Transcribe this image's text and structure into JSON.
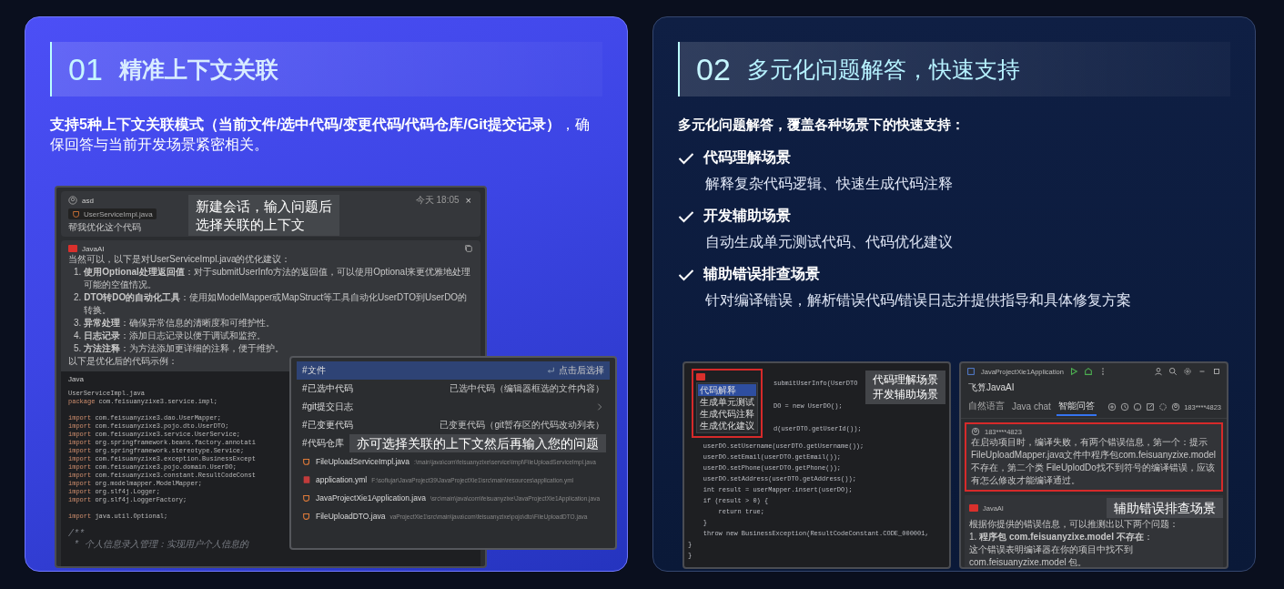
{
  "context_card": {
    "number": "01",
    "title": "精准上下文关联",
    "description": "**支持5种上下文关联模式（当前文件/选中代码/变更代码/代码仓库/Git提交记录）**，确保回答与当前开发场景紧密相关。",
    "chat_window": {
      "user": "asd",
      "file_chip": "UserServiceImpl.java",
      "time": "今天 18:05",
      "close": "×",
      "question": "帮我优化这个代码",
      "ai_name": "JavaAI",
      "intro": "当然可以，以下是对UserServiceImpl.java的优化建议：",
      "suggestions": [
        {
          "marker": "1.",
          "text": "**使用Optional处理返回值**：对于submitUserInfo方法的返回值，可以使用Optional来更优雅地处理可能的空值情况。"
        },
        {
          "marker": "2.",
          "text": "**DTO转DO的自动化工具**：使用如ModelMapper或MapStruct等工具自动化UserDTO到UserDO的转换。"
        },
        {
          "marker": "3.",
          "text": "**异常处理**：确保异常信息的清晰度和可维护性。"
        },
        {
          "marker": "4.",
          "text": "**日志记录**：添加日志记录以便于调试和监控。"
        },
        {
          "marker": "5.",
          "text": "**方法注释**：为方法添加更详细的注释，便于维护。"
        }
      ],
      "outro": "以下是优化后的代码示例：",
      "code_language": "Java",
      "code_lines": [
        {
          "kind": "plain",
          "text": "UserServiceImpl.java"
        },
        {
          "kind": "statement",
          "keyword": "package",
          "text": " com.feisuanyzixe3.service.impl;"
        },
        {
          "kind": "blank"
        },
        {
          "kind": "statement",
          "keyword": "import",
          "text": " com.feisuanyzixe3.dao.UserMapper;"
        },
        {
          "kind": "statement",
          "keyword": "import",
          "text": " com.feisuanyzixe3.pojo.dto.UserDTO;"
        },
        {
          "kind": "statement",
          "keyword": "import",
          "text": " com.feisuanyzixe3.service.UserService;"
        },
        {
          "kind": "statement",
          "keyword": "import",
          "text": " org.springframework.beans.factory.annotati"
        },
        {
          "kind": "statement",
          "keyword": "import",
          "text": " org.springframework.stereotype.Service;"
        },
        {
          "kind": "statement",
          "keyword": "import",
          "text": " com.feisuanyzixe3.exception.BusinessExcept"
        },
        {
          "kind": "statement",
          "keyword": "import",
          "text": " com.feisuanyzixe3.pojo.domain.UserDO;"
        },
        {
          "kind": "statement",
          "keyword": "import",
          "text": " com.feisuanyzixe3.constant.ResultCodeConst"
        },
        {
          "kind": "statement",
          "keyword": "import",
          "text": " org.modelmapper.ModelMapper;"
        },
        {
          "kind": "statement",
          "keyword": "import",
          "text": " org.slf4j.Logger;"
        },
        {
          "kind": "statement",
          "keyword": "import",
          "text": " org.slf4j.LoggerFactory;"
        },
        {
          "kind": "blank"
        },
        {
          "kind": "statement",
          "keyword": "import",
          "text": " java.util.Optional;"
        },
        {
          "kind": "blank"
        },
        {
          "kind": "comment",
          "text": "/**"
        },
        {
          "kind": "comment",
          "text": " * 个人信息录入管理：实现用户个人信息的"
        }
      ]
    },
    "context_popup": {
      "items": [
        {
          "kind": "hint",
          "label": "#文件",
          "hint": "点击后选择",
          "selected": true
        },
        {
          "kind": "hint",
          "label": "#已选中代码",
          "hint": "已选中代码（编辑器框选的文件内容）",
          "selected": false
        },
        {
          "kind": "submenu",
          "label": "#git提交日志",
          "selected": false
        },
        {
          "kind": "hint",
          "label": "#已变更代码",
          "hint": "已变更代码（git暂存区的代码改动列表）",
          "selected": false
        },
        {
          "kind": "plain",
          "label": "#代码仓库",
          "selected": false
        }
      ],
      "files": [
        {
          "kind": "java",
          "name": "FileUploadServiceImpl.java",
          "path": ":\\main\\java\\com\\feisuanyzixe\\service\\impl\\FileUploadServiceImpl.java"
        },
        {
          "kind": "yaml",
          "name": "application.yml",
          "path": "F:\\sofiujar\\JavaProject39\\JavaProjectXie1\\src\\main\\resources\\application.yml"
        },
        {
          "kind": "java",
          "name": "JavaProjectXie1Application.java",
          "path": "\\src\\main\\java\\com\\feisuanyzixe\\JavaProjectXie1Application.java"
        },
        {
          "kind": "java",
          "name": "FileUploadDTO.java",
          "path": "vaProjectXie1\\src\\main\\java\\com\\feisuanyzixe\\pojo\\dto\\FileUploadDTO.java"
        }
      ]
    },
    "callouts": [
      {
        "lines": [
          "新建会话，输入问题后",
          "选择关联的上下文"
        ]
      },
      {
        "lines": [
          "亦可选择关联的上下文然后再输入您的问题"
        ]
      }
    ]
  },
  "support_card": {
    "number": "02",
    "title": "多元化问题解答，快速支持",
    "lead": "多元化问题解答，覆盖各种场景下的快速支持：",
    "features": [
      {
        "title": "代码理解场景",
        "description": "解释复杂代码逻辑、快速生成代码注释"
      },
      {
        "title": "开发辅助场景",
        "description": "自动生成单元测试代码、代码优化建议"
      },
      {
        "title": "辅助错误排查场景",
        "description": "针对编译错误，解析错误代码/错误日志并提供指导和具体修复方案"
      }
    ],
    "editor_window": {
      "menu_items": [
        {
          "label": "代码解释",
          "selected": true
        },
        {
          "label": "生成单元测试",
          "selected": false
        },
        {
          "label": "生成代码注释",
          "selected": false
        },
        {
          "label": "生成优化建议",
          "selected": false
        }
      ],
      "code_lines": [
        {
          "kind": "beside_menu",
          "text": "submitUserInfo(UserDTO"
        },
        {
          "kind": "beside_menu",
          "text": "DO = new UserDO();"
        },
        {
          "kind": "beside_menu",
          "text": "d(userDTO.getUserId());"
        },
        {
          "kind": "body",
          "text": "    userDO.setUsername(userDTO.getUsername());"
        },
        {
          "kind": "body",
          "text": "    userDO.setEmail(userDTO.getEmail());"
        },
        {
          "kind": "body",
          "text": "    userDO.setPhone(userDTO.getPhone());"
        },
        {
          "kind": "body",
          "text": "    userDO.setAddress(userDTO.getAddress());"
        },
        {
          "kind": "body",
          "text": "    int result = userMapper.insert(userDO);"
        },
        {
          "kind": "body",
          "text": "    if (result > 0) {"
        },
        {
          "kind": "body",
          "text": "        return true;"
        },
        {
          "kind": "body",
          "text": "    }"
        },
        {
          "kind": "body",
          "text": "    throw new BusinessException(ResultCodeConstant.CODE_000001,"
        },
        {
          "kind": "body",
          "text": "}"
        },
        {
          "kind": "body",
          "text": "}"
        }
      ],
      "callout": {
        "lines": [
          "代码理解场景",
          "开发辅助场景"
        ]
      }
    },
    "ide_window": {
      "project": "JavaProjectXie1Application",
      "plugin_title": "飞算JavaAI",
      "tabs": [
        {
          "label": "自然语言",
          "selected": false
        },
        {
          "label": "Java chat",
          "selected": false
        },
        {
          "label": "智能问答",
          "selected": true
        }
      ],
      "account": "183****4823",
      "user": "183****4823",
      "user_message": "在启动项目时，编译失败，有两个错误信息，第一个：提示FileUploadMapper.java文件中程序包com.feisuanyzixe.model不存在，第二个类 FileUplodDo找不到符号的编译错误，应该有怎么修改才能编译通过。",
      "ai_name": "JavaAI",
      "ai_lines": [
        "根据你提供的错误信息，可以推测出以下两个问题：",
        "1. **程序包 com.feisuanyzixe.model 不存在**：",
        "这个错误表明编译器在你的项目中找不到 com.feisuanyzixe.model 包。"
      ],
      "callout": {
        "lines": [
          "辅助错误排查场景"
        ]
      }
    }
  }
}
